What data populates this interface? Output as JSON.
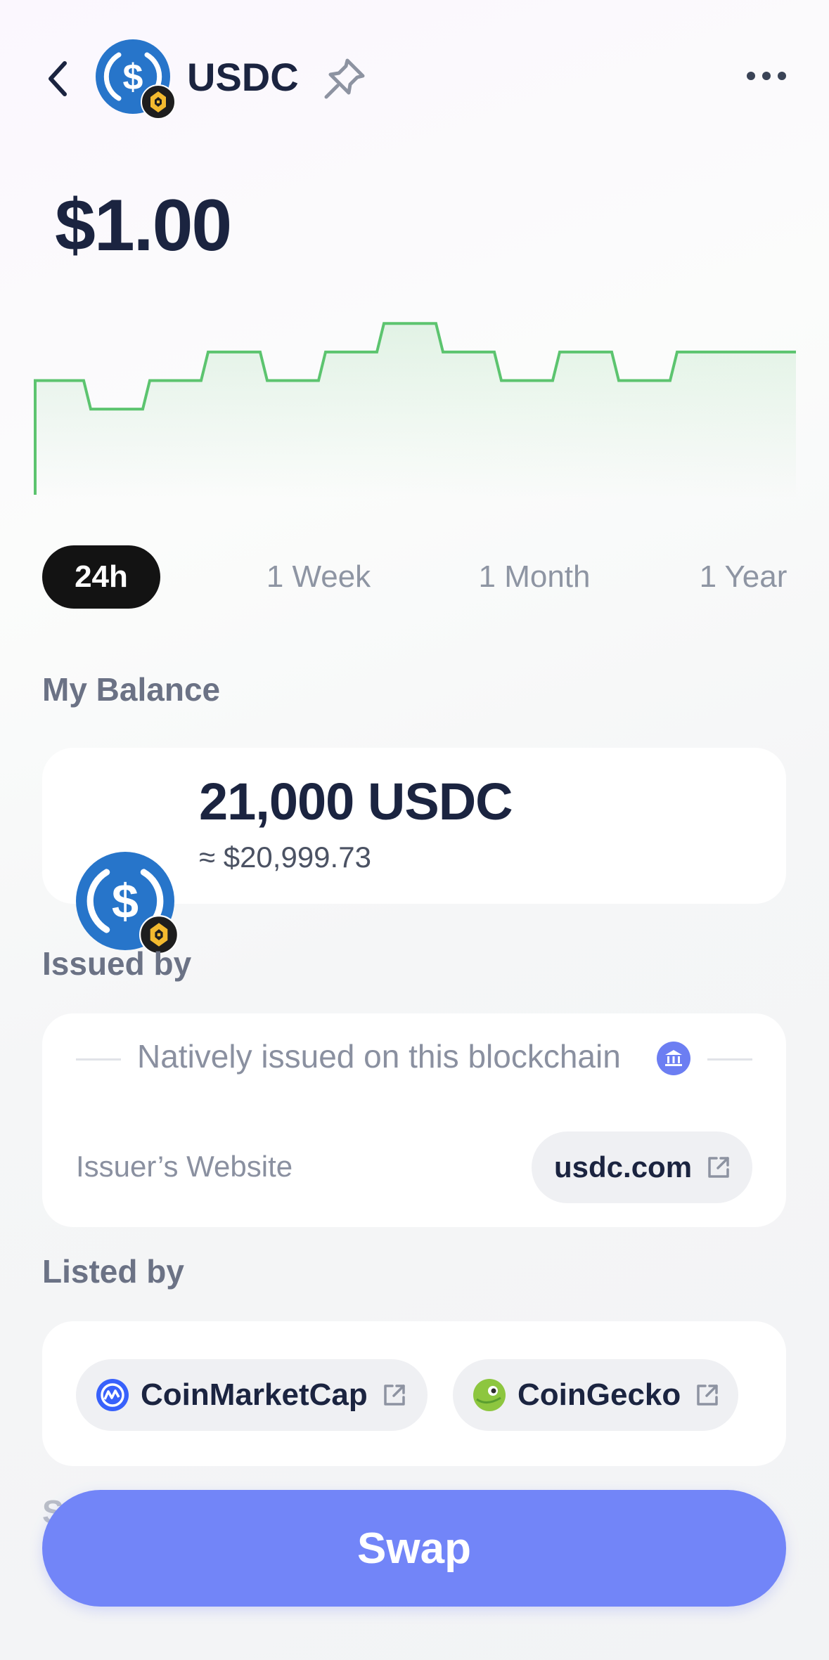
{
  "header": {
    "title": "USDC",
    "back_icon": "chevron-left-icon",
    "pin_icon": "pin-icon",
    "more_icon": "more-horizontal-icon"
  },
  "price": "$1.00",
  "chart_data": {
    "type": "line",
    "style": "step",
    "color": "#5cc46f",
    "x": [
      0,
      1,
      2,
      3,
      4,
      5,
      6,
      7,
      8,
      9,
      10,
      11,
      12
    ],
    "y": [
      1.0,
      0.9,
      1.0,
      1.1,
      1.0,
      1.1,
      1.2,
      1.1,
      1.0,
      1.1,
      1.0,
      1.1,
      1.1
    ],
    "grid": false
  },
  "ranges": {
    "items": [
      "24h",
      "1 Week",
      "1 Month",
      "1 Year"
    ],
    "selected": "24h"
  },
  "balance": {
    "heading": "My Balance",
    "amount": "21,000 USDC",
    "fiat": "≈ $20,999.73"
  },
  "issued": {
    "heading": "Issued by",
    "native_text": "Natively issued on this blockchain",
    "website_label": "Issuer’s Website",
    "website": "usdc.com"
  },
  "listed": {
    "heading": "Listed by",
    "items": [
      "CoinMarketCap",
      "CoinGecko"
    ]
  },
  "faded_heading": "S",
  "swap_label": "Swap",
  "colors": {
    "accent": "#7285f8",
    "usdc_blue": "#2775ca",
    "chart_green": "#5cc46f",
    "bnb_yellow": "#f3ba2f"
  }
}
